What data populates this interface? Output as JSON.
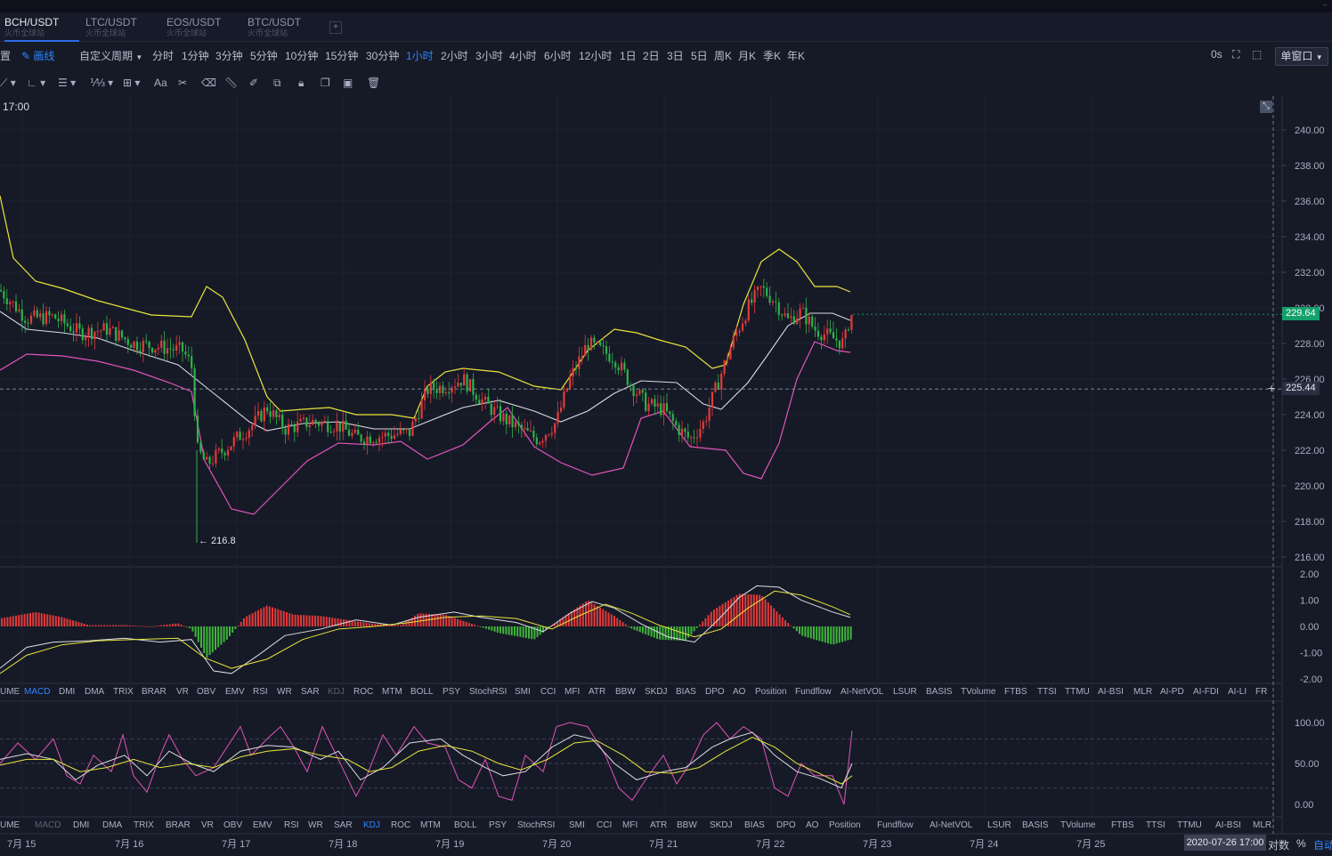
{
  "tabs": [
    {
      "pair": "BCH/USDT",
      "source": "火币全球站",
      "active": true
    },
    {
      "pair": "LTC/USDT",
      "source": "火币全球站",
      "active": false
    },
    {
      "pair": "EOS/USDT",
      "source": "火币全球站",
      "active": false
    },
    {
      "pair": "BTC/USDT",
      "source": "火币全球站",
      "active": false
    }
  ],
  "tab_add_label": "+",
  "toolbar": {
    "settings_partial": "置",
    "draw_label": "画线",
    "custom_period_label": "自定义周期",
    "periods": [
      "分时",
      "1分钟",
      "3分钟",
      "5分钟",
      "10分钟",
      "15分钟",
      "30分钟",
      "1小时",
      "2小时",
      "3小时",
      "4小时",
      "6小时",
      "12小时",
      "1日",
      "2日",
      "3日",
      "5日",
      "周K",
      "月K",
      "季K",
      "年K"
    ],
    "selected_period": "1小时",
    "countdown": "0s",
    "window_mode": "单窗口"
  },
  "drawing_tools": [
    "trend-line",
    "angle-line",
    "parallel-lines",
    "fib-tool",
    "rectangle-grid",
    "text-tool",
    "brush",
    "eraser",
    "ruler",
    "pencil",
    "pattern",
    "lock",
    "copy",
    "screenshot",
    "delete"
  ],
  "drawing_text": {
    "text_tool": "Aa",
    "fib": "⅟⅓"
  },
  "main_chart": {
    "time_label": "17:00",
    "price_axis": [
      "240.00",
      "238.00",
      "236.00",
      "234.00",
      "232.00",
      "230.00",
      "228.00",
      "226.00",
      "224.00",
      "222.00",
      "220.00",
      "218.00",
      "216.00"
    ],
    "current_price": "229.64",
    "crosshair_price": "225.44",
    "low_marker": "← 216.8",
    "colors": {
      "up": "#e43a3a",
      "down": "#2fb24a",
      "upper_band": "#e8e53b",
      "mid_band": "#d9dbe3",
      "lower_band": "#e054b8",
      "price_tag": "#14a06b"
    }
  },
  "macd_panel": {
    "axis": [
      "2.00",
      "1.00",
      "0.00",
      "-1.00",
      "-2.00"
    ],
    "indicators": [
      "UME",
      "MACD",
      "DMI",
      "DMA",
      "TRIX",
      "BRAR",
      "VR",
      "OBV",
      "EMV",
      "RSI",
      "WR",
      "SAR",
      "KDJ",
      "ROC",
      "MTM",
      "BOLL",
      "PSY",
      "StochRSI",
      "SMI",
      "CCI",
      "MFI",
      "ATR",
      "BBW",
      "SKDJ",
      "BIAS",
      "DPO",
      "AO",
      "Position",
      "Fundflow",
      "AI-NetVOL",
      "LSUR",
      "BASIS",
      "TVolume",
      "FTBS",
      "TTSI",
      "TTMU",
      "AI-BSI",
      "MLR",
      "AI-PD",
      "AI-FDI",
      "AI-LI",
      "FR"
    ],
    "selected": "MACD",
    "dim": "KDJ"
  },
  "kdj_panel": {
    "axis": [
      "100.00",
      "50.00",
      "0.00"
    ],
    "indicators": [
      "UME",
      "MACD",
      "DMI",
      "DMA",
      "TRIX",
      "BRAR",
      "VR",
      "OBV",
      "EMV",
      "RSI",
      "WR",
      "SAR",
      "KDJ",
      "ROC",
      "MTM",
      "BOLL",
      "PSY",
      "StochRSI",
      "SMI",
      "CCI",
      "MFI",
      "ATR",
      "BBW",
      "SKDJ",
      "BIAS",
      "DPO",
      "AO",
      "Position",
      "Fundflow",
      "AI-NetVOL",
      "LSUR",
      "BASIS",
      "TVolume",
      "FTBS",
      "TTSI",
      "TTMU",
      "AI-BSI",
      "MLR"
    ],
    "selected": "KDJ",
    "dim": "MACD"
  },
  "time_axis": [
    "7月 15",
    "7月 16",
    "7月 17",
    "7月 18",
    "7月 19",
    "7月 20",
    "7月 21",
    "7月 22",
    "7月 23",
    "7月 24",
    "7月 25"
  ],
  "crosshair_date": "2020-07-26 17:00",
  "footer": {
    "log_label": "对数",
    "percent_label": "%",
    "auto_label": "自动"
  }
}
